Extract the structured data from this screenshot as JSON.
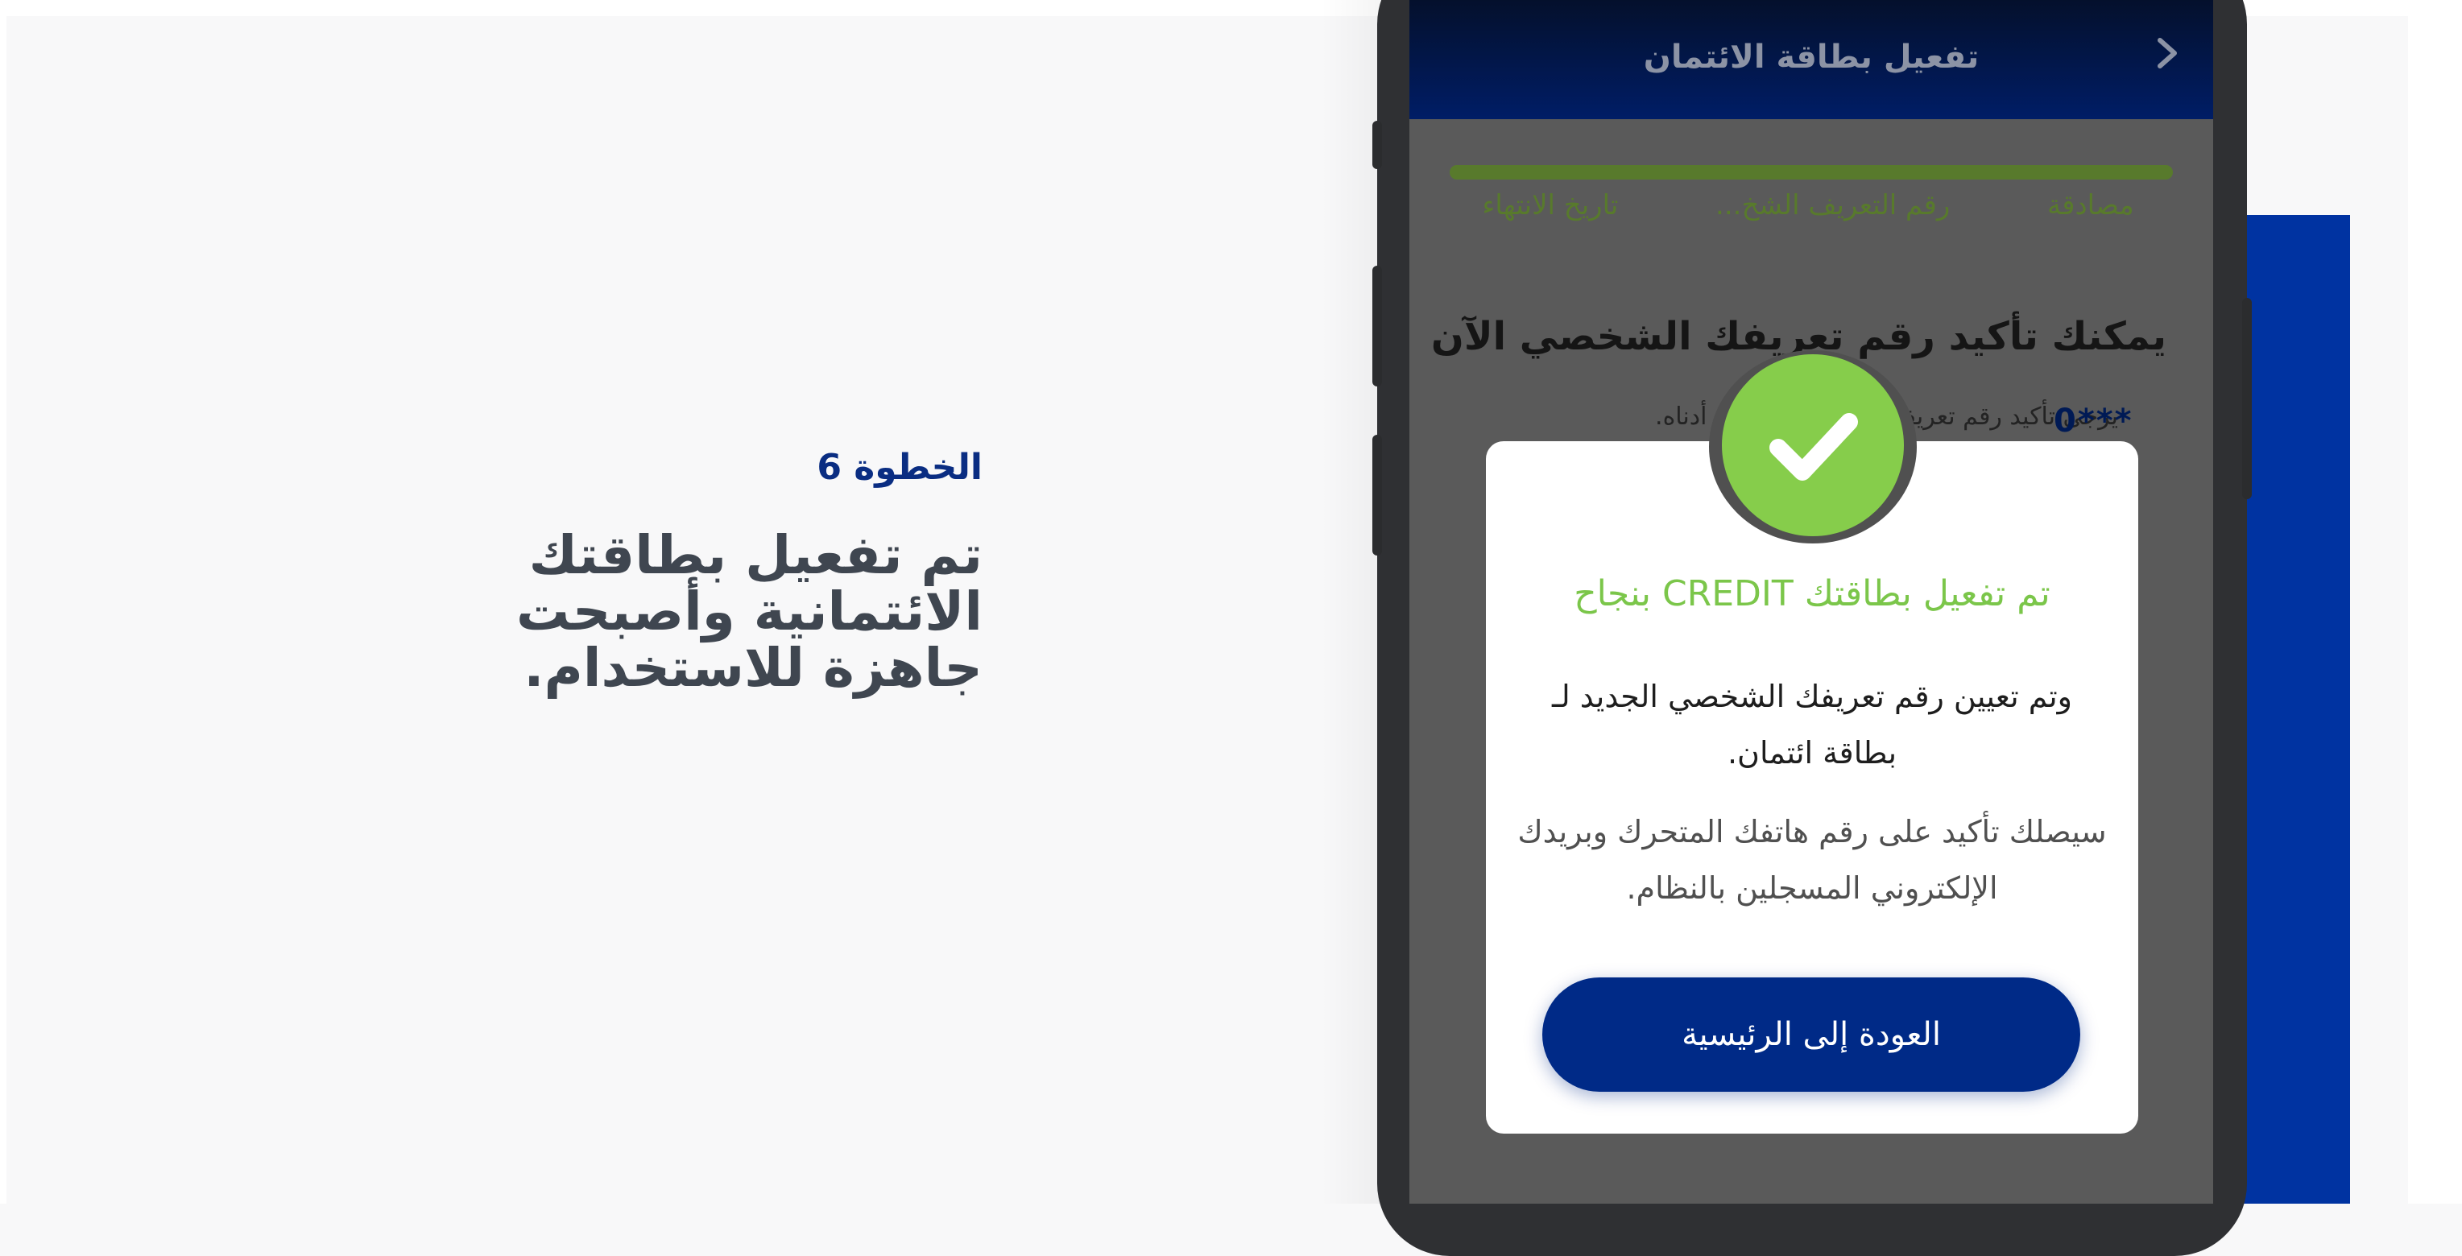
{
  "intro": {
    "step_label": "الخطوة 6",
    "description_lines": [
      "تم تفعيل بطاقتك",
      "الائتمانية وأصبحت",
      "جاهزة للاستخدام."
    ]
  },
  "app": {
    "header_title": "تفعيل بطاقة الائتمان",
    "back_icon": "chevron-right-icon",
    "progress": 1.0,
    "steps": [
      "تاريخ الانتهاء",
      "رقم التعريف الشخ...",
      "مصادقة"
    ],
    "heading": "يمكنك تأكيد رقم تعريفك الشخصي الآن",
    "subtext": "يرجى تأكيد رقم تعريفك الشخصي الجديد أدناه.",
    "pin_masked": "0***"
  },
  "modal": {
    "icon": "checkmark-icon",
    "title": "تم تفعيل بطاقتك CREDIT بنجاح",
    "pin_message": "وتم تعيين رقم تعريفك الشخصي الجديد لـ بطاقة ائتمان.",
    "confirm_message": "سيصلك تأكيد على رقم هاتفك المتحرك وبريدك الإلكتروني المسجلين بالنظام.",
    "home_button": "العودة إلى الرئيسية"
  },
  "colors": {
    "brand_navy": "#002a87",
    "accent_blue": "#0033a1",
    "success_green": "#86cd4b",
    "step_label": "#0a2d82",
    "body_text": "#3f4650"
  }
}
